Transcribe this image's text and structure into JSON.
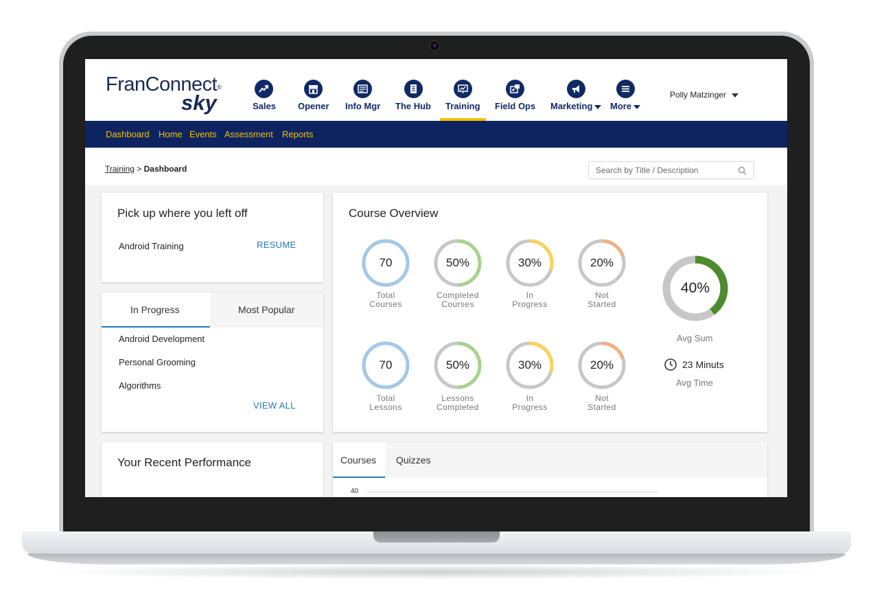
{
  "app": {
    "logo_text": "FranConnect",
    "logo_reg": "®",
    "logo_sky": "sky",
    "user_name": "Polly Matzinger"
  },
  "nav": [
    {
      "label": "Sales",
      "icon": "chart-trend-icon"
    },
    {
      "label": "Opener",
      "icon": "store-icon"
    },
    {
      "label": "Info Mgr",
      "icon": "info-card-icon"
    },
    {
      "label": "The Hub",
      "icon": "document-icon"
    },
    {
      "label": "Training",
      "icon": "presentation-icon",
      "active": true
    },
    {
      "label": "Field Ops",
      "icon": "field-ops-icon"
    },
    {
      "label": "Marketing",
      "icon": "megaphone-icon",
      "dropdown": true
    },
    {
      "label": "More",
      "icon": "menu-icon",
      "dropdown": true
    }
  ],
  "subnav": [
    "Dashboard",
    "Home",
    "Events",
    "Assessment",
    "Reports"
  ],
  "breadcrumb": {
    "link": "Training",
    "separator": ">",
    "current": "Dashboard"
  },
  "search": {
    "placeholder": "Search by Title / Description"
  },
  "pickup": {
    "title": "Pick up where you left off",
    "item": "Android Training",
    "button": "RESUME"
  },
  "course_tabs": {
    "tabs": [
      "In Progress",
      "Most Popular"
    ],
    "active": "In Progress",
    "items": [
      "Android Development",
      "Personal Grooming",
      "Algorithms"
    ],
    "view_all": "VIEW ALL"
  },
  "overview": {
    "title": "Course Overview",
    "row1": [
      {
        "value": "70",
        "fraction": 1.0,
        "color": "#a4c8e8",
        "label1": "Total",
        "label2": "Courses"
      },
      {
        "value": "50%",
        "fraction": 0.5,
        "color": "#a9d18e",
        "label1": "Completed",
        "label2": "Courses"
      },
      {
        "value": "30%",
        "fraction": 0.3,
        "color": "#f7d35c",
        "label1": "In",
        "label2": "Progress"
      },
      {
        "value": "20%",
        "fraction": 0.2,
        "color": "#f2b083",
        "label1": "Not",
        "label2": "Started"
      }
    ],
    "row2": [
      {
        "value": "70",
        "fraction": 1.0,
        "color": "#a4c8e8",
        "label1": "Total",
        "label2": "Lessons"
      },
      {
        "value": "50%",
        "fraction": 0.5,
        "color": "#a9d18e",
        "label1": "Lessons",
        "label2": "Completed"
      },
      {
        "value": "30%",
        "fraction": 0.3,
        "color": "#f7d35c",
        "label1": "In",
        "label2": "Progress"
      },
      {
        "value": "20%",
        "fraction": 0.2,
        "color": "#f2b083",
        "label1": "Not",
        "label2": "Started"
      }
    ],
    "avg_sum": {
      "value": "40%",
      "fraction": 0.4,
      "color": "#4e8a2e",
      "label": "Avg Sum"
    },
    "avg_time": {
      "value": "23 Minuts",
      "label": "Avg Time"
    }
  },
  "performance": {
    "title": "Your Recent Performance",
    "tabs": [
      "Courses",
      "Quizzes"
    ],
    "active": "Courses",
    "y_tick": "40"
  },
  "colors": {
    "navy": "#0d2461",
    "nav_icon": "#102a66",
    "accent_yellow": "#f5c200",
    "link_blue": "#2478b8",
    "ring_track": "#c7c7c7"
  }
}
